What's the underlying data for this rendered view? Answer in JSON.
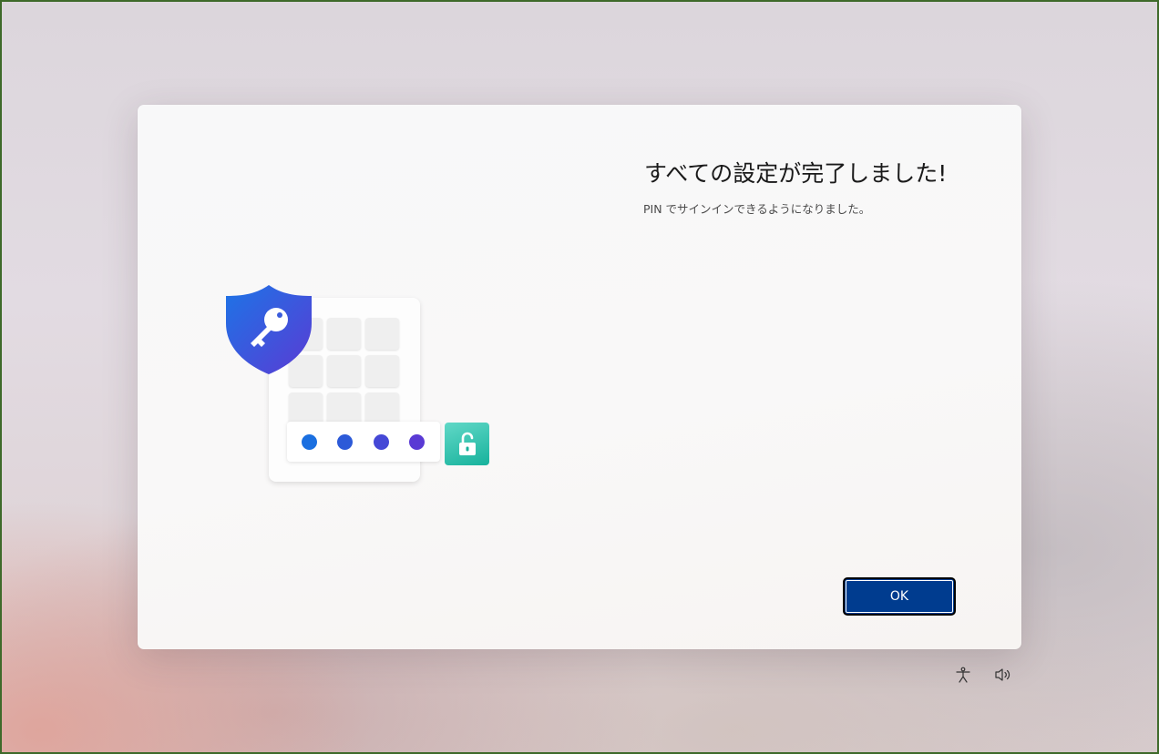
{
  "dialog": {
    "title": "すべての設定が完了しました!",
    "subtitle": "PIN でサインインできるようになりました。",
    "ok_label": "OK"
  },
  "illustration": {
    "shield_icon": "key-shield-icon",
    "lock_icon": "unlocked-padlock-icon",
    "pin_dot_colors": [
      "#1a6fe0",
      "#2c5ad8",
      "#4548d6",
      "#5a3ad4"
    ],
    "lock_tile_color": "#17b29c"
  },
  "tray": {
    "accessibility_icon": "accessibility-icon",
    "volume_icon": "volume-icon"
  },
  "colors": {
    "ok_button": "#003c8f",
    "screen_border": "#3e6a2a"
  }
}
